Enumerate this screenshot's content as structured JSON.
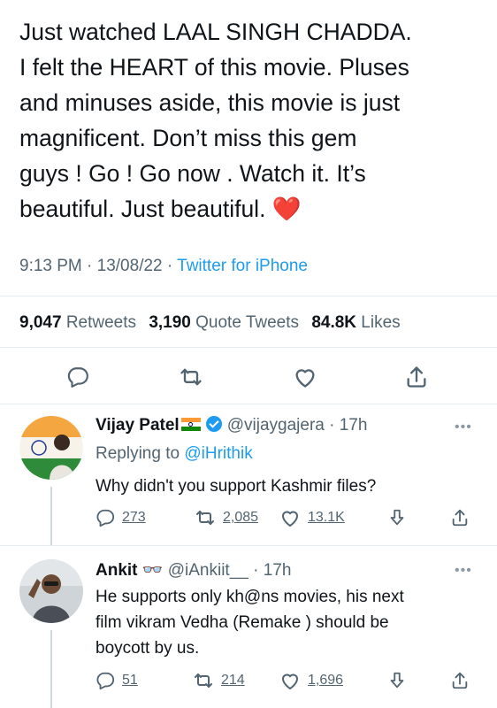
{
  "tweet": {
    "lines": [
      "Just watched LAAL SINGH CHADDA.",
      "I felt the HEART of this movie. Pluses",
      "and minuses aside, this movie is just",
      "magnificent. Don’t miss this gem",
      "guys ! Go ! Go now . Watch it. It’s",
      "beautiful. Just beautiful."
    ],
    "emoji": "❤️",
    "time": "9:13 PM · 13/08/22 · ",
    "client": "Twitter for iPhone"
  },
  "stats": {
    "retweets_count": "9,047",
    "retweets_label": "Retweets",
    "quote_count": "3,190",
    "quote_label": "Quote Tweets",
    "likes_count": "84.8K",
    "likes_label": "Likes"
  },
  "replies": [
    {
      "name": "Vijay Patel",
      "handle": "@vijaygajera",
      "time": "· 17h",
      "replying_prefix": "Replying to ",
      "replying_to": "@iHrithik",
      "lines": [
        "Why didn't you support Kashmir files?"
      ],
      "reply_count": "273",
      "retweet_count": "2,085",
      "like_count": "13.1K"
    },
    {
      "name": "Ankit",
      "name_emoji": "👓",
      "handle": "@iAnkiit__",
      "time": "· 17h",
      "lines": [
        "He supports only kh@ns movies, his next",
        "film vikram Vedha (Remake ) should be",
        "boycott by us."
      ],
      "reply_count": "51",
      "retweet_count": "214",
      "like_count": "1,696"
    }
  ],
  "icons": {
    "reply": "reply-icon",
    "retweet": "retweet-icon",
    "like": "heart-icon",
    "share": "share-icon",
    "downvote": "downvote-icon",
    "more": "more-icon"
  },
  "colors": {
    "link": "#1d9bf0",
    "muted": "#536471",
    "text": "#0f1419",
    "heart": "#e0245e"
  }
}
